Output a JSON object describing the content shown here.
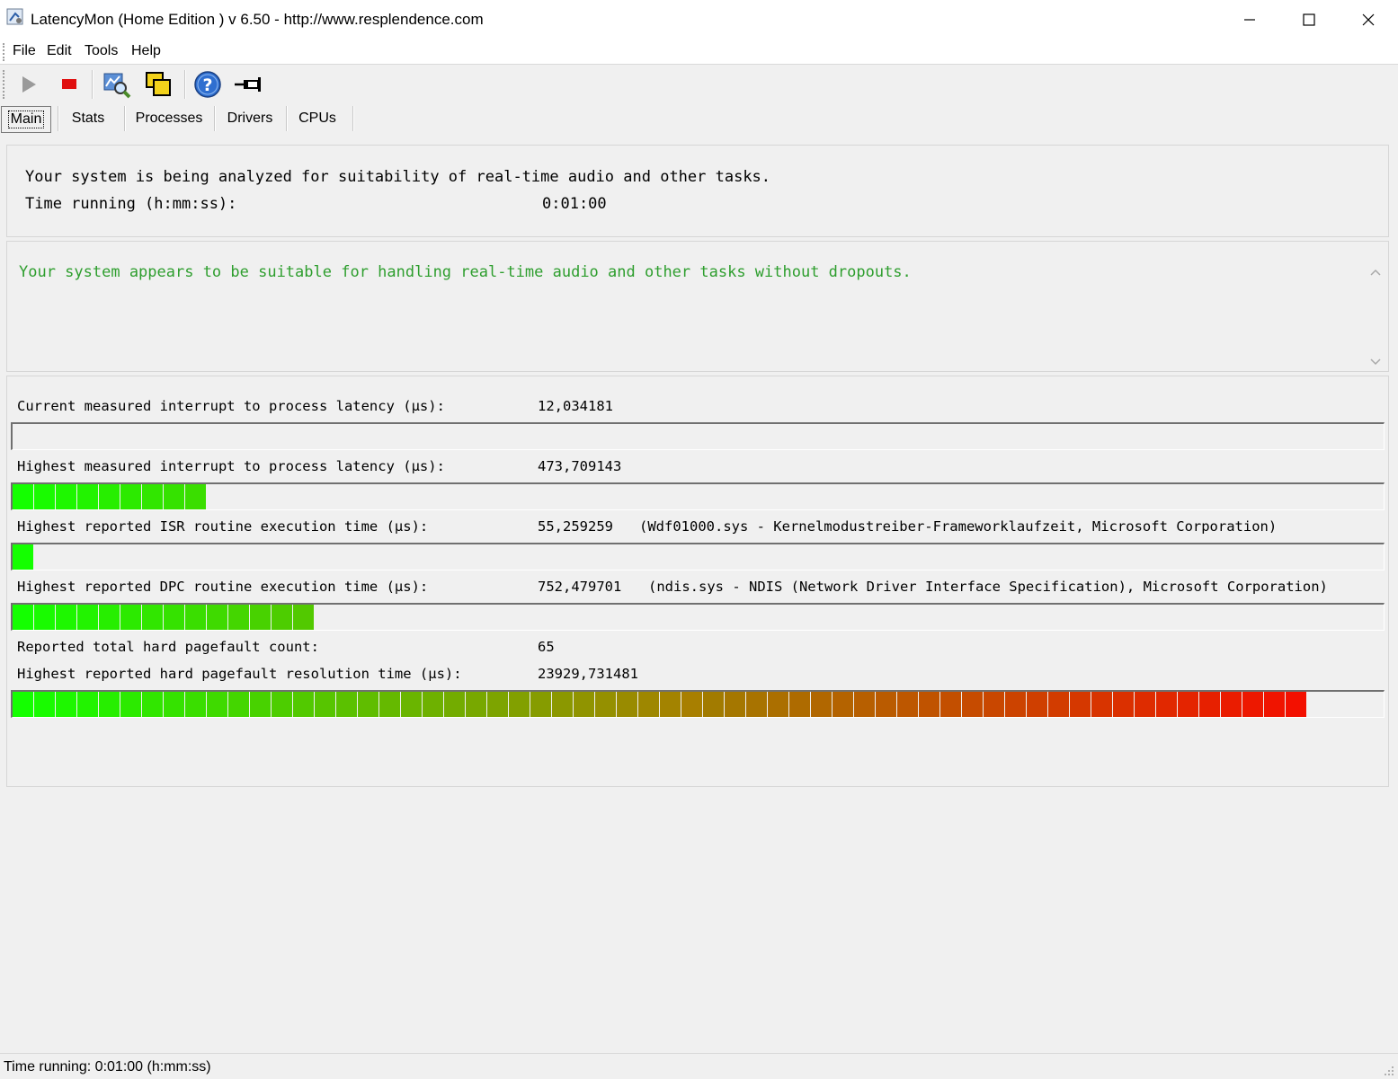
{
  "window": {
    "title": "LatencyMon  (Home Edition )  v 6.50 - http://www.resplendence.com"
  },
  "menu": [
    "File",
    "Edit",
    "Tools",
    "Help"
  ],
  "toolbar": {
    "icons": [
      "play-icon",
      "stop-icon",
      "magnifier-icon",
      "windows-icon",
      "help-icon",
      "pin-icon"
    ]
  },
  "tabs": [
    "Main",
    "Stats",
    "Processes",
    "Drivers",
    "CPUs"
  ],
  "summary": {
    "analyzing": "Your system is being analyzed for suitability of real-time audio and other tasks.",
    "time_label": "Time running (h:mm:ss):",
    "time_value": "0:01:00"
  },
  "verdict": {
    "text": "Your system appears to be suitable for handling real-time audio and other tasks without dropouts.",
    "color": "#2e9e2e"
  },
  "metrics": {
    "current_latency": {
      "label": "Current measured interrupt to process latency (µs):",
      "value": "12,034181",
      "level": 0
    },
    "highest_latency": {
      "label": "Highest measured interrupt to process latency (µs):",
      "value": "473,709143",
      "level": 0.142
    },
    "isr": {
      "label": "Highest reported ISR routine execution time (µs):",
      "value": "55,259259",
      "detail": "(Wdf01000.sys - Kernelmodustreiber-Frameworklaufzeit, Microsoft Corporation)",
      "level": 0.016
    },
    "dpc": {
      "label": "Highest reported DPC routine execution time (µs):",
      "value": "752,479701",
      "detail": "(ndis.sys - NDIS (Network Driver Interface Specification), Microsoft Corporation)",
      "level": 0.221
    },
    "pagefault_count": {
      "label": "Reported total hard pagefault count:",
      "value": "65"
    },
    "pagefault_time": {
      "label": "Highest reported hard pagefault resolution time (µs):",
      "value": "23929,731481",
      "level": 0.952
    }
  },
  "status": {
    "text": "Time running: 0:01:00  (h:mm:ss)"
  }
}
